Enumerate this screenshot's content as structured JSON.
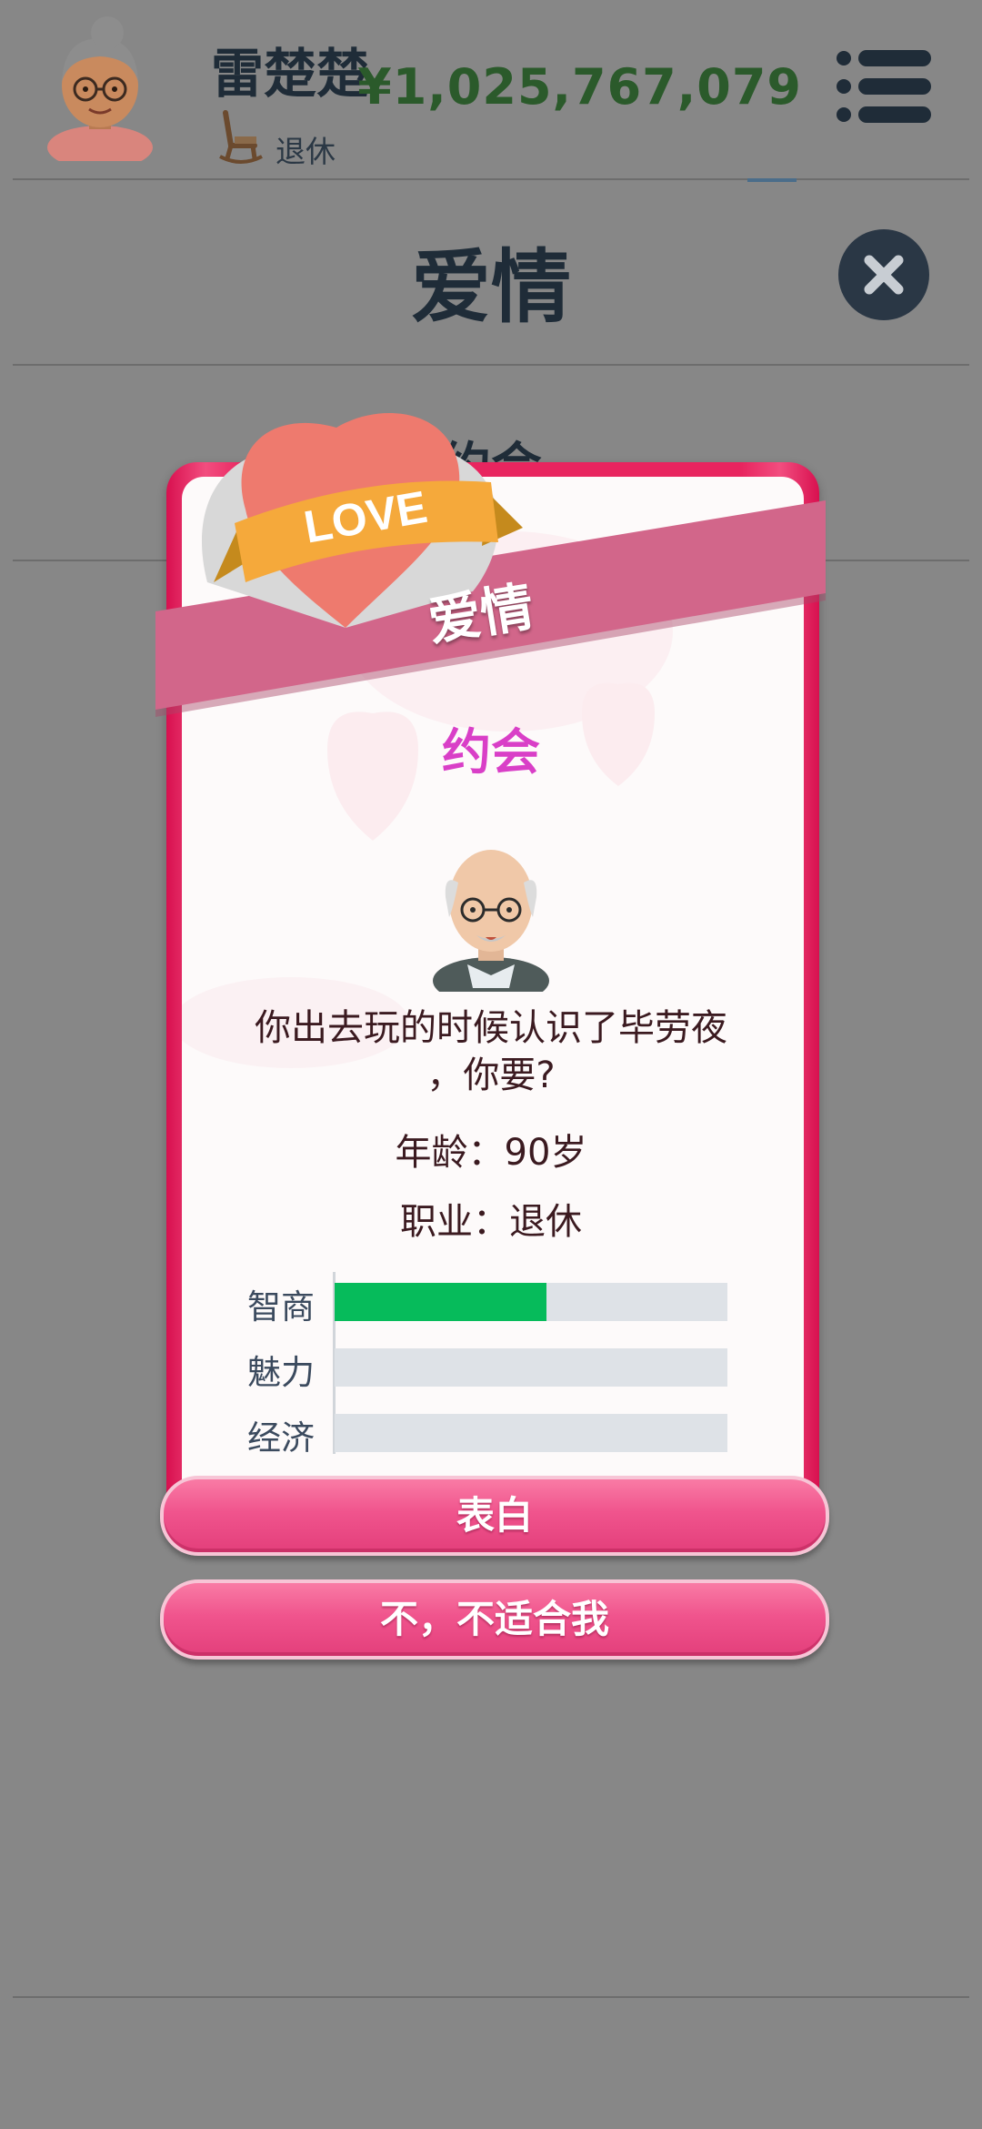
{
  "header": {
    "player_name": "雷楚楚",
    "job_label": "退休",
    "money": "¥1,025,767,079",
    "money_color": "#2b5a2b"
  },
  "page": {
    "title": "爱情",
    "background_subtitle": "约会"
  },
  "dialog": {
    "badge_text": "LOVE",
    "banner_title": "爱情",
    "event_title": "约会",
    "question_line1": "你出去玩的时候认识了毕劳夜",
    "question_line2": "，你要?",
    "age_line": "年龄：90岁",
    "job_line": "职业：退休",
    "stats": [
      {
        "label": "智商",
        "value": 0.54,
        "color": "#06bb5b"
      },
      {
        "label": "魅力",
        "value": 0.0,
        "color": "#06bb5b"
      },
      {
        "label": "经济",
        "value": 0.0,
        "color": "#06bb5b"
      }
    ],
    "confess_button": "表白",
    "decline_button": "不，不适合我"
  },
  "icons": {
    "avatar": "old-woman-avatar-icon",
    "job": "rocking-chair-icon",
    "menu": "menu-list-icon",
    "close": "close-icon",
    "npc": "old-man-portrait-icon"
  },
  "colors": {
    "accent_pink": "#e8255f",
    "event_title": "#d93fc7",
    "banner": "#d2668a"
  }
}
